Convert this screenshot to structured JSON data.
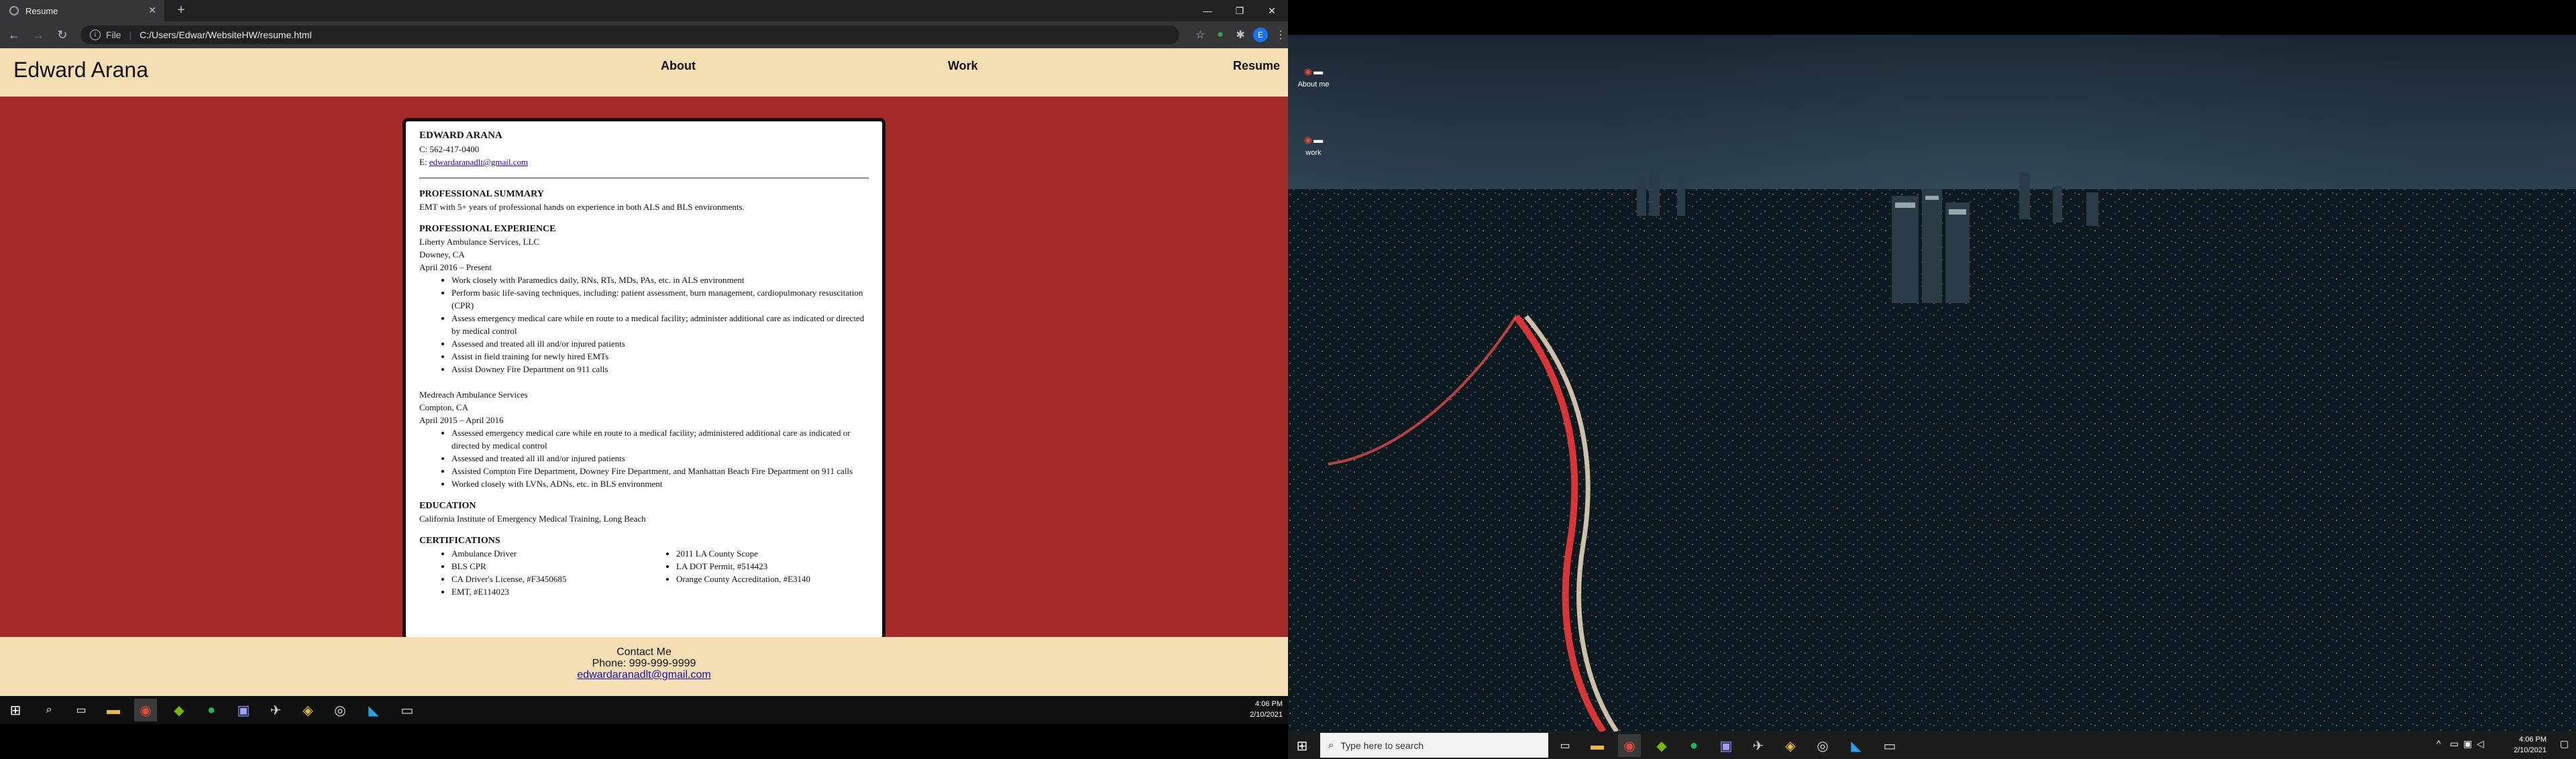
{
  "browser": {
    "tab_title": "Resume",
    "url_scheme": "File",
    "url": "C:/Users/Edwar/WebsiteHW/resume.html"
  },
  "site": {
    "name": "Edward Arana",
    "nav": [
      "About",
      "Work",
      "Resume"
    ]
  },
  "resume": {
    "name": "EDWARD ARANA",
    "phone": "C: 562-417-0400",
    "email_prefix": "E:",
    "email": "edwardaranadlt@gmail.com",
    "summary_heading": "PROFESSIONAL SUMMARY",
    "summary": "EMT with 5+ years of professional hands on experience in both ALS and BLS environments.",
    "experience_heading": "PROFESSIONAL EXPERIENCE",
    "jobs": [
      {
        "company": "Liberty Ambulance Services, LLC",
        "location": "Downey, CA",
        "dates": "April 2016 – Present",
        "duties": [
          "Work closely with Paramedics daily, RNs, RTs, MDs, PAs, etc. in ALS environment",
          "Perform basic life-saving techniques, including: patient assessment, burn management, cardiopulmonary resuscitation (CPR)",
          "Assess emergency medical care while en route to a medical facility; administer additional care as indicated or directed by medical control",
          "Assessed and treated all ill and/or injured patients",
          "Assist in field training for newly hired EMTs",
          "Assist Downey Fire Department on 911 calls"
        ]
      },
      {
        "company": "Medreach Ambulance Services",
        "location": "Compton, CA",
        "dates": "April 2015 – April 2016",
        "duties": [
          "Assessed emergency medical care while en route to a medical facility; administered additional care as indicated or directed by medical control",
          "Assessed and treated all ill and/or injured patients",
          "Assisted Compton Fire Department, Downey Fire Department, and Manhattan Beach Fire Department on 911 calls",
          " Worked closely with LVNs, ADNs, etc. in BLS environment"
        ]
      }
    ],
    "education_heading": "EDUCATION",
    "education": "California Institute of Emergency Medical Training, Long Beach",
    "certs_heading": "CERTIFICATIONS",
    "certs_left": [
      "Ambulance Driver",
      "BLS CPR",
      "CA Driver's License, #F3450685",
      "EMT, #E114023"
    ],
    "certs_right": [
      "2011 LA County Scope",
      "LA DOT Permit, #514423",
      "Orange County Accreditation, #E3140"
    ]
  },
  "footer": {
    "contact": "Contact Me",
    "phone": "Phone: 999-999-9999",
    "email": "edwardaranadlt@gmail.com"
  },
  "taskbar_left": {
    "time": "4:06 PM",
    "date": "2/10/2021"
  },
  "desktop": {
    "icons": [
      "About me",
      "work"
    ]
  },
  "taskbar_right": {
    "search_placeholder": "Type here to search",
    "time": "4:06 PM",
    "date": "2/10/2021"
  }
}
